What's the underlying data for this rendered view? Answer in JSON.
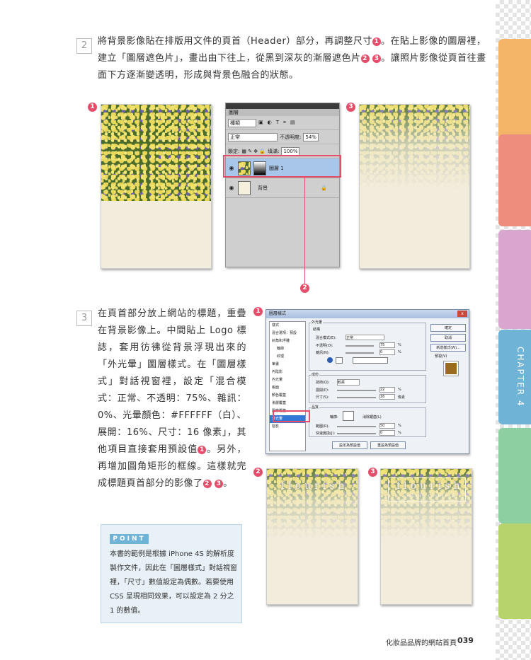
{
  "step2": {
    "number": "2",
    "text_a": "將背景影像貼在排版用文件的頁首（Header）部分，再調整尺寸",
    "text_b": "。在貼上影像的圖層裡，建立「圖層遮色片」，畫出由下往上，從黑到深灰的漸層遮色片",
    "text_c": "。讓照片影像從頁首往畫面下方逐漸變透明，形成與背景色融合的狀態。"
  },
  "markers": {
    "one": "1",
    "two": "2",
    "three": "3"
  },
  "layers_panel": {
    "tab": "圖層",
    "kind": "種類",
    "blend": "正常",
    "opacity_label": "不透明度:",
    "opacity_value": "54%",
    "lock_label": "鎖定:",
    "fill_label": "填滿:",
    "fill_value": "100%",
    "layer1": "圖層 1",
    "layer2": "背景"
  },
  "step3": {
    "number": "3",
    "text_a": "在頁首部分放上網站的標題，重疊在背景影像上。中間貼上 Logo 標誌，套用彷彿從背景浮現出來的「外光暈」圖層樣式。在「圖層樣式」對話視窗裡，設定「混合模式：正常、不透明：75%、雜訊：0%、光暈顏色：#FFFFFF（白）、展開：16%、尺寸：16 像素」，其他項目直接套用預設值",
    "text_b": "。另外，再增加圓角矩形的框線。這樣就完成標題頁首部分的影像了"
  },
  "dialog": {
    "title": "圖層樣式",
    "close": "x",
    "styles": [
      "樣式",
      "混合選項：預設",
      "斜角和浮雕",
      "輪廓",
      "紋理",
      "筆畫",
      "內陰影",
      "內光暈",
      "緞面",
      "顏色覆蓋",
      "漸層覆蓋",
      "圖樣覆蓋",
      "外光暈",
      "陰影"
    ],
    "section_outer_glow": "外光暈",
    "section_structure": "結構",
    "blend_label": "混合模式(E):",
    "blend_value": "正常",
    "opacity_label": "不透明(O):",
    "opacity_value": "75",
    "noise_label": "雜訊(N):",
    "noise_value": "0",
    "percent": "%",
    "section_elements": "成份",
    "technique_label": "技術(Q):",
    "technique_value": "較柔",
    "spread_label": "展開(P):",
    "spread_value": "22",
    "size_label": "尺寸(S):",
    "size_value": "16",
    "px": "像素",
    "section_quality": "品質",
    "contour_label": "輪廓:",
    "antialias_label": "消除鋸齒(L)",
    "range_label": "範圍(R):",
    "range_value": "50",
    "jitter_label": "快速變換(J):",
    "jitter_value": "0",
    "default_btn": "設定為預設值",
    "reset_btn": "重設為預設值",
    "ok": "確定",
    "cancel": "取消",
    "new_style": "新增樣式(W)...",
    "preview": "預視(V)"
  },
  "logo": {
    "text": "flourish",
    "sub": "ORGANIC COSMETICS"
  },
  "point": {
    "tag": "POINT",
    "text": "本書的範例是根據 iPhone 4S 的解析度製作文件，因此在「圖層樣式」對話視窗裡，「尺寸」數值設定為偶數。若要使用 CSS 呈現相同效果，可以設定為 2 分之 1 的數值。"
  },
  "sidebar": {
    "chapter": "CHAPTER 4"
  },
  "footer": {
    "title": "化妝品品牌的網站首頁",
    "page": "039"
  },
  "colors": {
    "accent": "#e54e6a",
    "chapter_blue": "#6fb3d6",
    "paper": "#f2ecdc"
  }
}
